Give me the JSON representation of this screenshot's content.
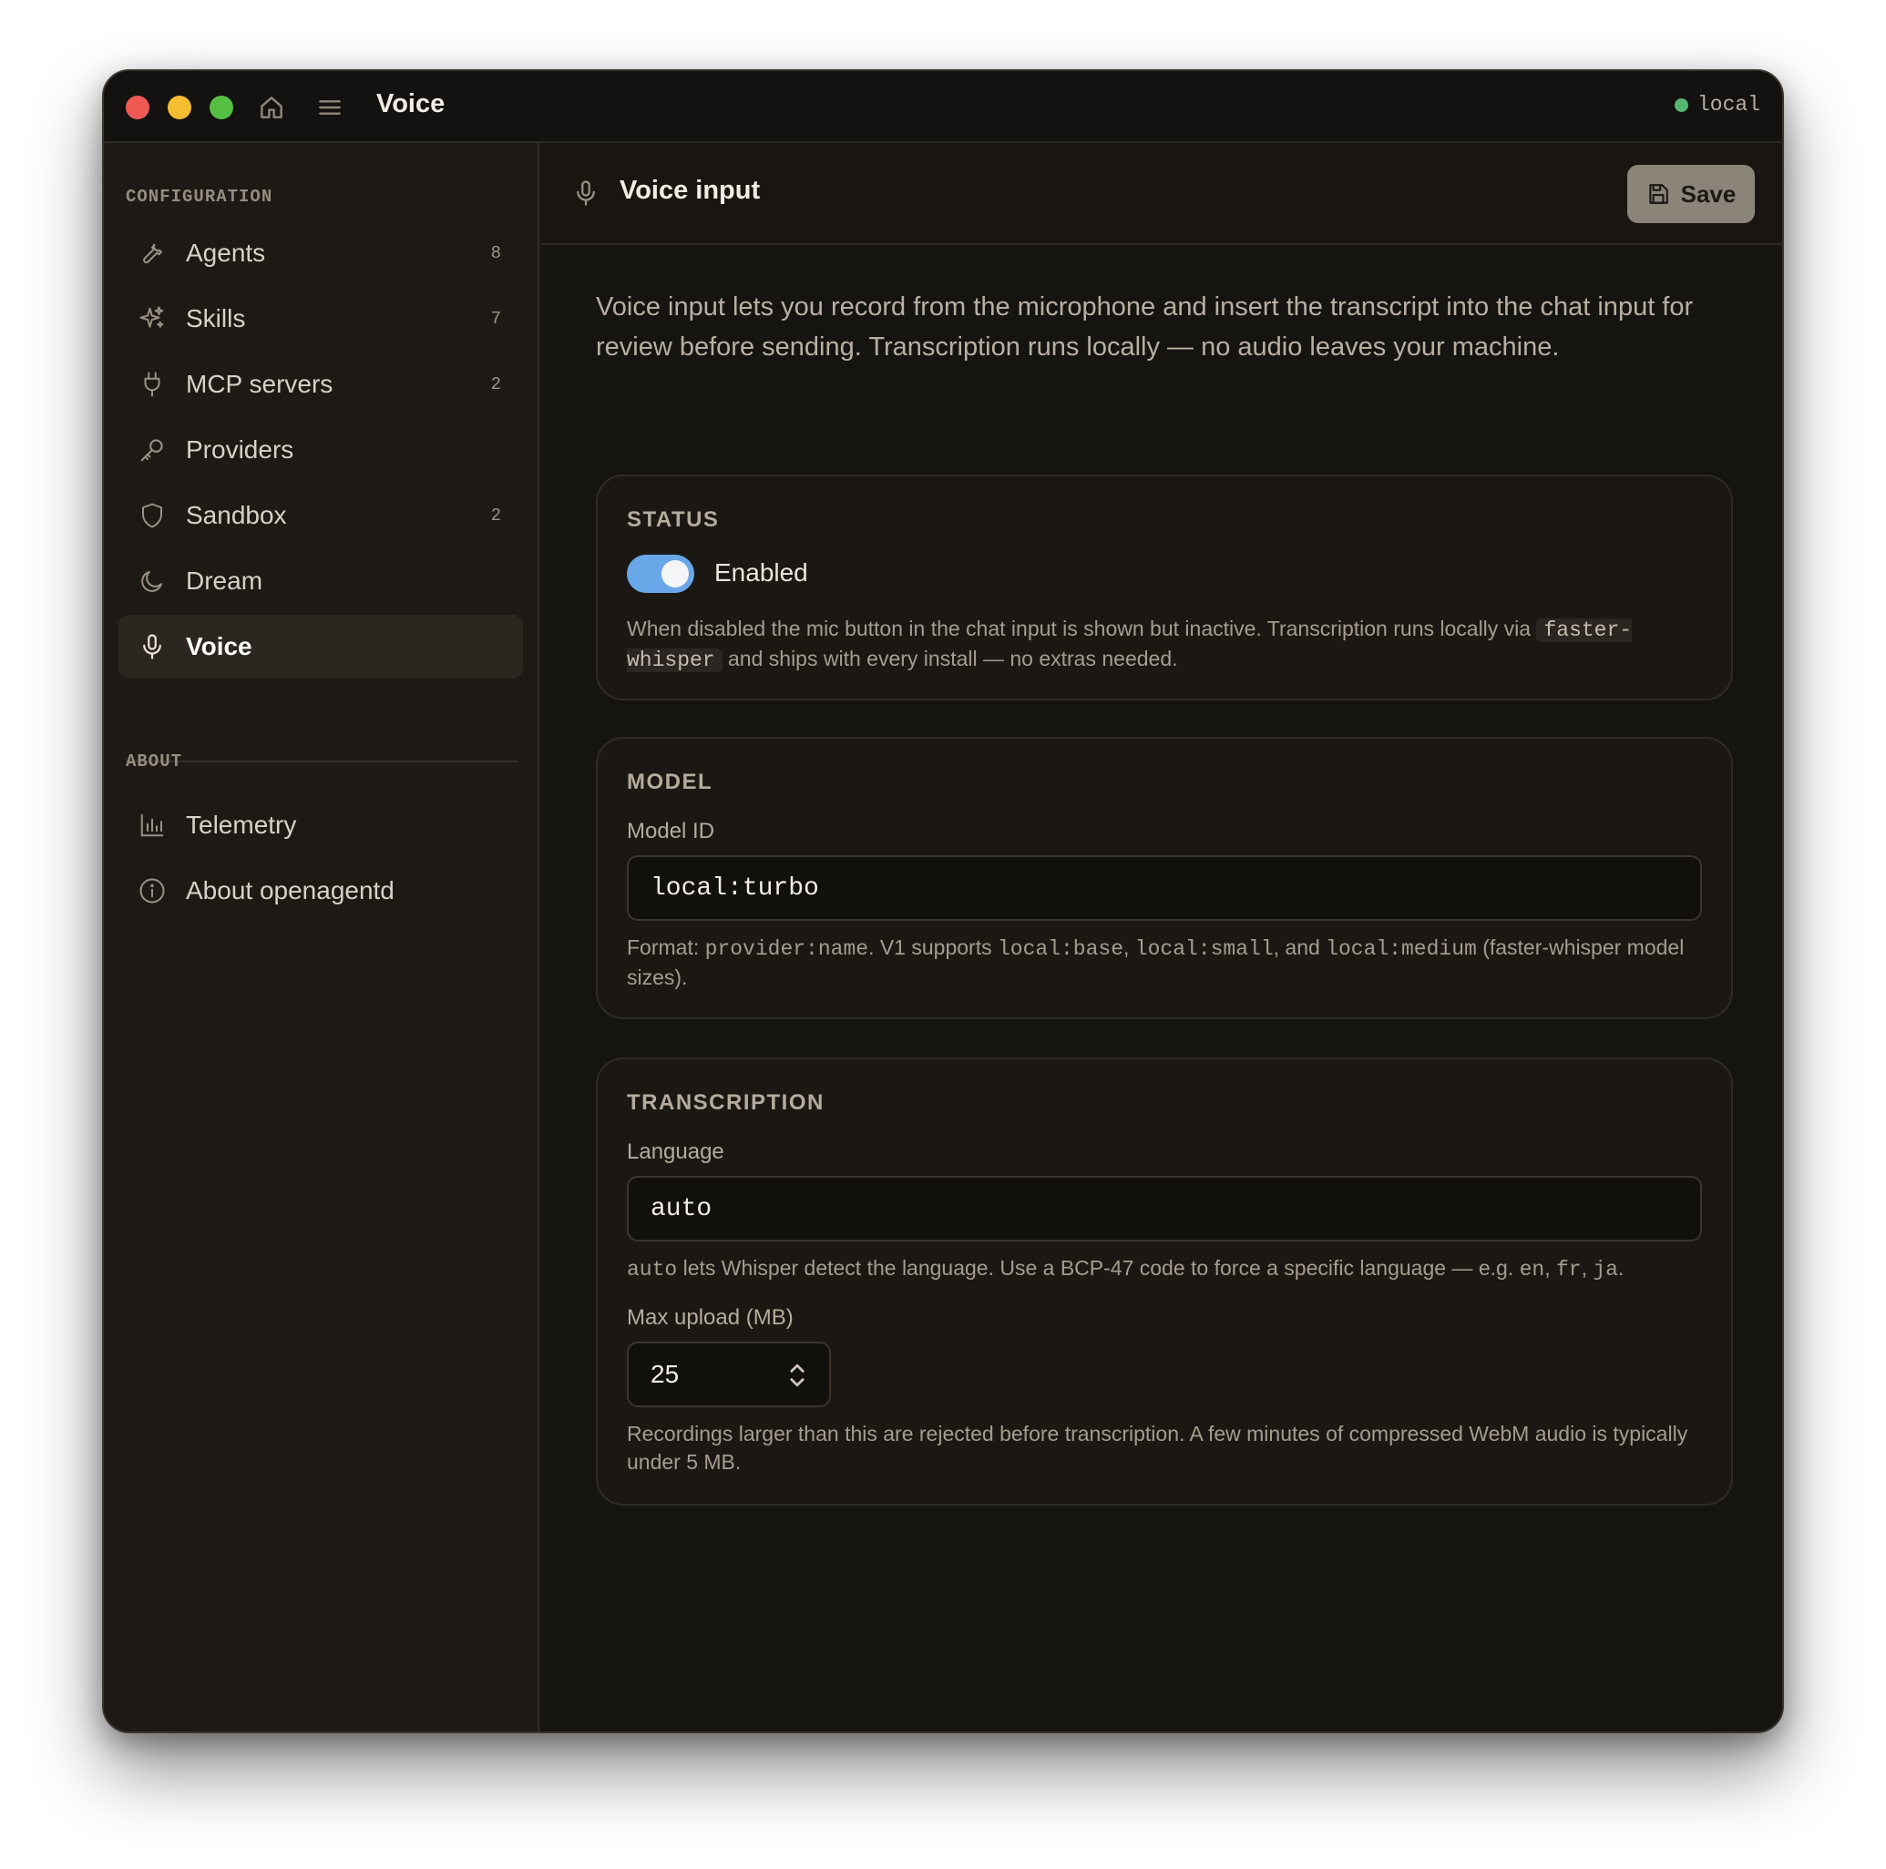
{
  "window": {
    "title": "Voice",
    "connection": {
      "label": "local",
      "status_color": "#55b771"
    }
  },
  "sidebar": {
    "configuration_label": "CONFIGURATION",
    "about_label": "ABOUT",
    "items": [
      {
        "label": "Agents",
        "count": "8",
        "icon": "wrench-icon"
      },
      {
        "label": "Skills",
        "count": "7",
        "icon": "sparkles-icon"
      },
      {
        "label": "MCP servers",
        "count": "2",
        "icon": "plug-icon"
      },
      {
        "label": "Providers",
        "count": "",
        "icon": "key-icon"
      },
      {
        "label": "Sandbox",
        "count": "2",
        "icon": "shield-icon"
      },
      {
        "label": "Dream",
        "count": "",
        "icon": "moon-icon"
      },
      {
        "label": "Voice",
        "count": "",
        "icon": "microphone-icon",
        "active": true
      }
    ],
    "about_items": [
      {
        "label": "Telemetry",
        "icon": "bar-chart-icon"
      },
      {
        "label": "About openagentd",
        "icon": "info-icon"
      }
    ]
  },
  "main": {
    "header_title": "Voice input",
    "save_label": "Save",
    "intro": "Voice input lets you record from the microphone and insert the transcript into the chat input for review before sending. Transcription runs locally — no audio leaves your machine.",
    "status": {
      "title": "STATUS",
      "toggle_label": "Enabled",
      "toggle_on": true,
      "help_before": "When disabled the mic button in the chat input is shown but inactive. Transcription runs locally via ",
      "help_code": "faster-whisper",
      "help_after": " and ships with every install — no extras needed."
    },
    "model": {
      "title": "MODEL",
      "field_label": "Model ID",
      "value": "local:turbo",
      "help": {
        "t1": "Format: ",
        "c1": "provider:name",
        "t2": ". V1 supports ",
        "c2": "local:base",
        "t3": ", ",
        "c3": "local:small",
        "t4": ", and ",
        "c4": "local:medium",
        "t5": " (faster-whisper model sizes)."
      }
    },
    "transcription": {
      "title": "TRANSCRIPTION",
      "language_label": "Language",
      "language_value": "auto",
      "language_help": {
        "c1": "auto",
        "t1": " lets Whisper detect the language. Use a BCP-47 code to force a specific language — e.g. ",
        "c2": "en",
        "t2": ", ",
        "c3": "fr",
        "t3": ", ",
        "c4": "ja",
        "t4": "."
      },
      "max_upload_label": "Max upload (MB)",
      "max_upload_value": "25",
      "max_upload_help": "Recordings larger than this are rejected before transcription. A few minutes of compressed WebM audio is typically under 5 MB."
    }
  }
}
